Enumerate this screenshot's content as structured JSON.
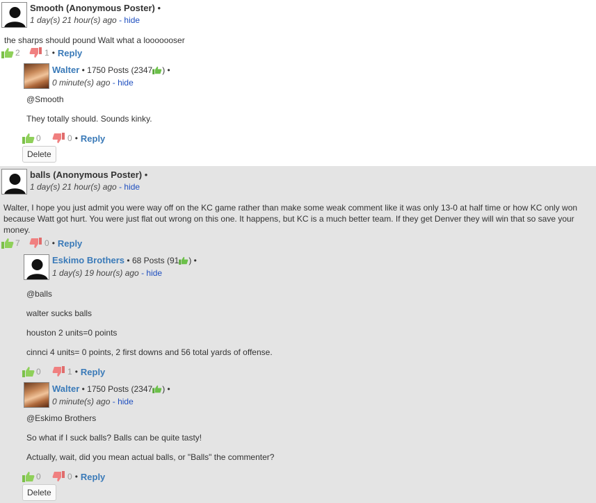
{
  "comments": [
    {
      "author": "Smooth (Anonymous Poster)",
      "bullet": "•",
      "time": "1 day(s) 21 hour(s) ago",
      "sep": "-",
      "hide": "hide",
      "body": [
        "the sharps should pound Walt what a looooooser"
      ],
      "up": "2",
      "down": "1",
      "reply": "Reply"
    },
    {
      "author": "Walter",
      "posts": "1750 Posts (2347",
      "posts_end": ") •",
      "bullet_pre": "•",
      "time": "0 minute(s) ago",
      "sep": "-",
      "hide": "hide",
      "body": [
        "@Smooth",
        "They totally should. Sounds kinky."
      ],
      "up": "0",
      "down": "0",
      "reply": "Reply",
      "delete": "Delete"
    },
    {
      "author": "balls (Anonymous Poster)",
      "bullet": "•",
      "time": "1 day(s) 21 hour(s) ago",
      "sep": "-",
      "hide": "hide",
      "body": [
        "Walter, I hope you just admit you were way off on the KC game rather than make some weak comment like it was only 13-0 at half time or how KC only won because Watt got hurt. You were just flat out wrong on this one. It happens, but KC is a much better team. If they get Denver they will win that so save your money."
      ],
      "up": "7",
      "down": "0",
      "reply": "Reply"
    },
    {
      "author": "Eskimo Brothers",
      "posts": "68 Posts (91",
      "posts_end": ") •",
      "bullet_pre": "•",
      "time": "1 day(s) 19 hour(s) ago",
      "sep": "-",
      "hide": "hide",
      "body": [
        "@balls",
        "walter sucks balls",
        "houston 2 units=0 points",
        "cinnci 4 units= 0 points, 2 first downs and 56 total yards of offense."
      ],
      "up": "0",
      "down": "1",
      "reply": "Reply"
    },
    {
      "author": "Walter",
      "posts": "1750 Posts (2347",
      "posts_end": ") •",
      "bullet_pre": "•",
      "time": "0 minute(s) ago",
      "sep": "-",
      "hide": "hide",
      "body": [
        "@Eskimo Brothers",
        "So what if I suck balls? Balls can be quite tasty!",
        "Actually, wait, did you mean actual balls, or \"Balls\" the commenter?"
      ],
      "up": "0",
      "down": "0",
      "reply": "Reply",
      "delete": "Delete"
    }
  ],
  "colors": {
    "link": "#3a7ab8",
    "hide": "#1f4fbf",
    "thread_bg": "#e4e4e4",
    "up": "#7cc04a",
    "down": "#e06c6c"
  }
}
